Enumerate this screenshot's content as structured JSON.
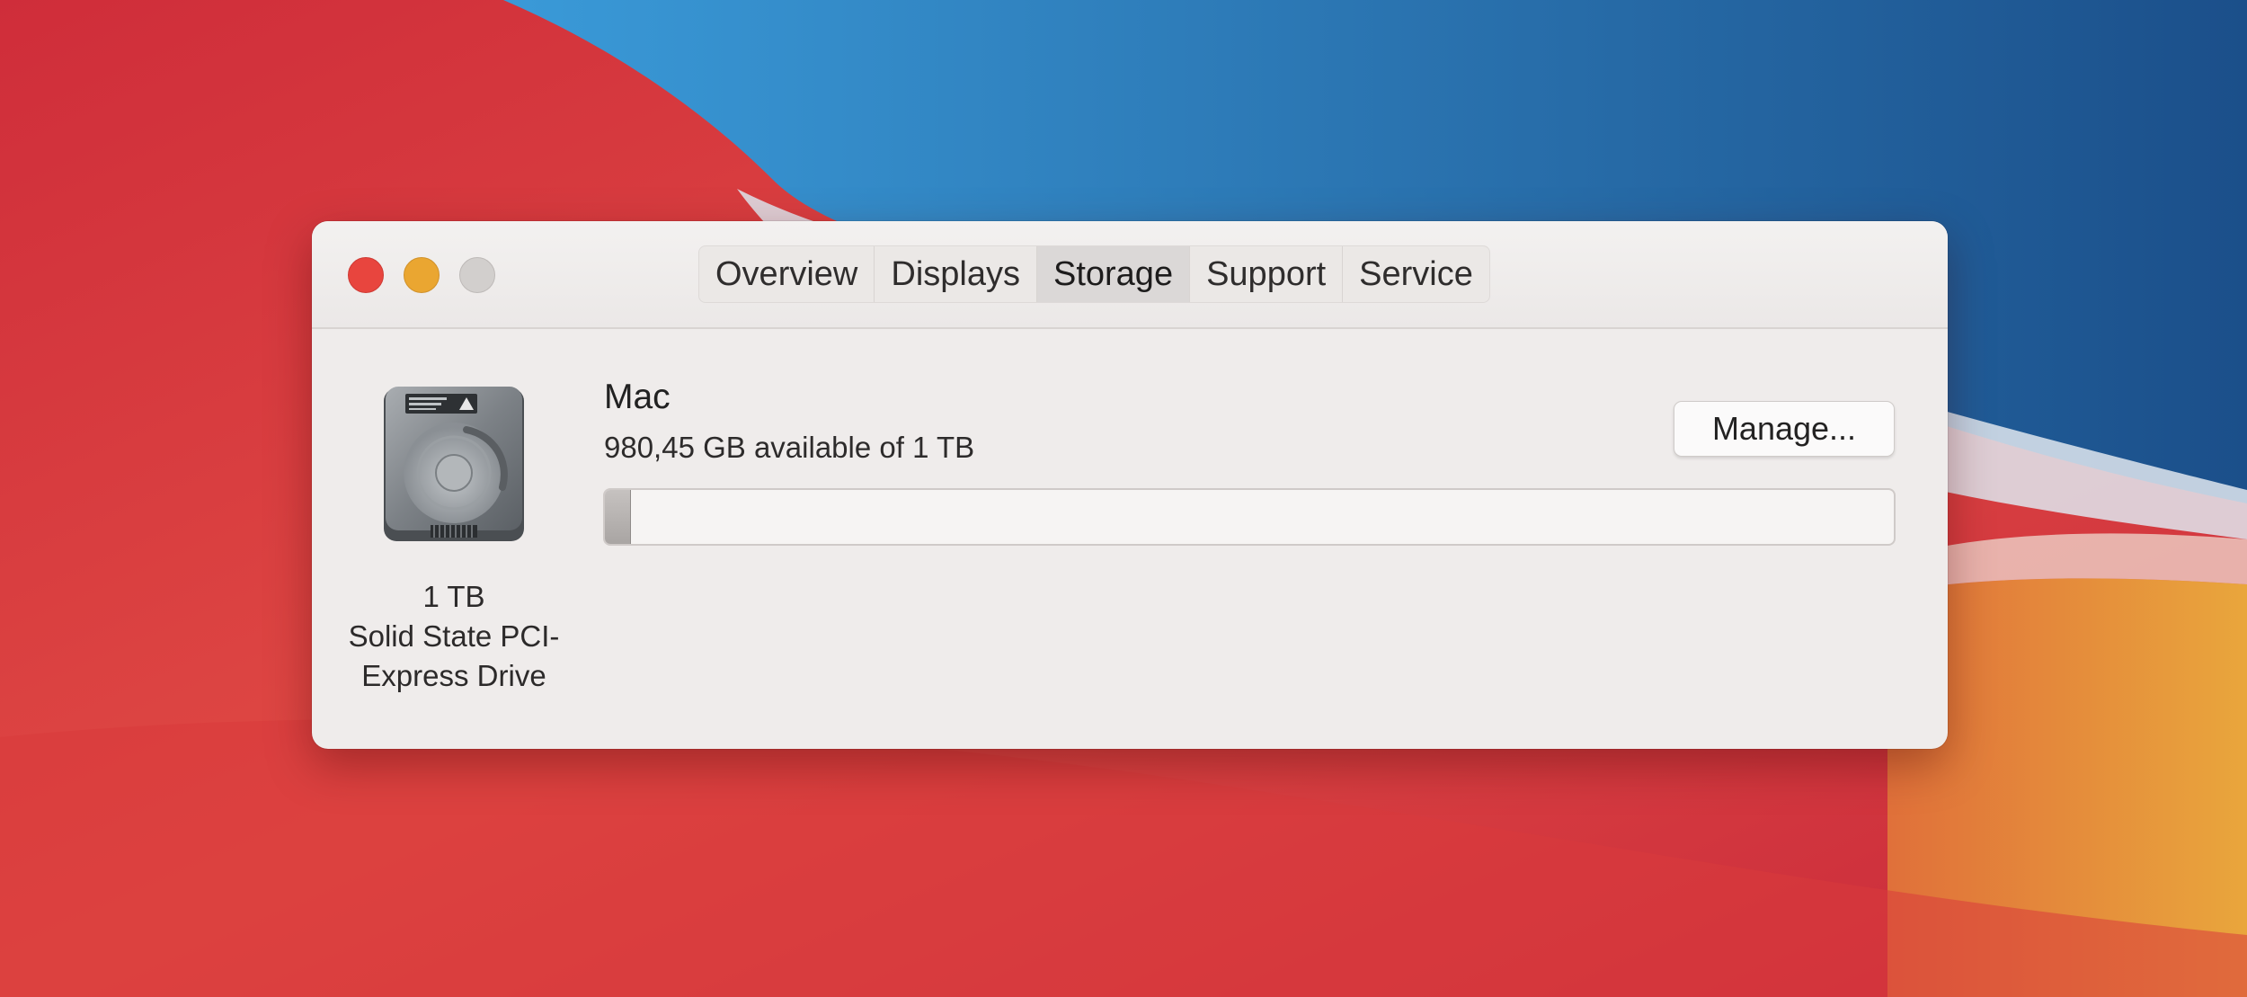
{
  "window": {
    "tabs": [
      {
        "label": "Overview",
        "active": false
      },
      {
        "label": "Displays",
        "active": false
      },
      {
        "label": "Storage",
        "active": true
      },
      {
        "label": "Support",
        "active": false
      },
      {
        "label": "Service",
        "active": false
      }
    ],
    "traffic_lights": {
      "close_color": "#e8453e",
      "minimize_color": "#eaa631",
      "zoom_color": "#d2cfcd"
    }
  },
  "drive": {
    "icon": "hard-drive-icon",
    "capacity": "1 TB",
    "type_line1": "Solid State PCI-",
    "type_line2": "Express Drive"
  },
  "volume": {
    "name": "Mac",
    "availability": "980,45 GB available of 1 TB",
    "used_fraction": 0.0195
  },
  "actions": {
    "manage_label": "Manage..."
  },
  "colors": {
    "wallpaper_red": "#d2323e",
    "wallpaper_blue": "#2b7fc0",
    "wallpaper_orange": "#e2a03a"
  }
}
